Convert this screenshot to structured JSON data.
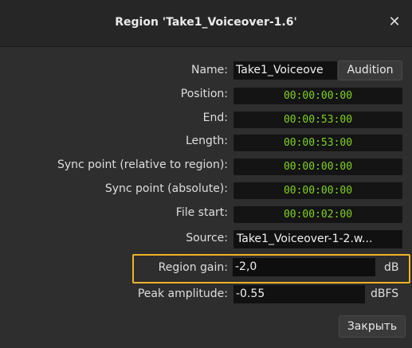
{
  "window": {
    "title": "Region 'Take1_Voiceover-1.6'",
    "close_icon": "close-icon"
  },
  "form": {
    "name": {
      "label": "Name:",
      "value": "Take1_Voiceove",
      "audition_label": "Audition"
    },
    "position": {
      "label": "Position:",
      "value": "00:00:00:00"
    },
    "end": {
      "label": "End:",
      "value": "00:00:53:00"
    },
    "length": {
      "label": "Length:",
      "value": "00:00:53:00"
    },
    "sync_relative": {
      "label": "Sync point (relative to region):",
      "value": "00:00:00:00"
    },
    "sync_absolute": {
      "label": "Sync point (absolute):",
      "value": "00:00:00:00"
    },
    "file_start": {
      "label": "File start:",
      "value": "00:00:02:00"
    },
    "source": {
      "label": "Source:",
      "value": "Take1_Voiceover-1-2.w..."
    },
    "region_gain": {
      "label": "Region gain:",
      "value": "-2,0",
      "unit": "dB"
    },
    "peak_amplitude": {
      "label": "Peak amplitude:",
      "value": "-0.55",
      "unit": "dBFS"
    }
  },
  "footer": {
    "close_label": "Закрыть"
  },
  "colors": {
    "clock_green": "#7ed321",
    "highlight": "#f0b323"
  }
}
